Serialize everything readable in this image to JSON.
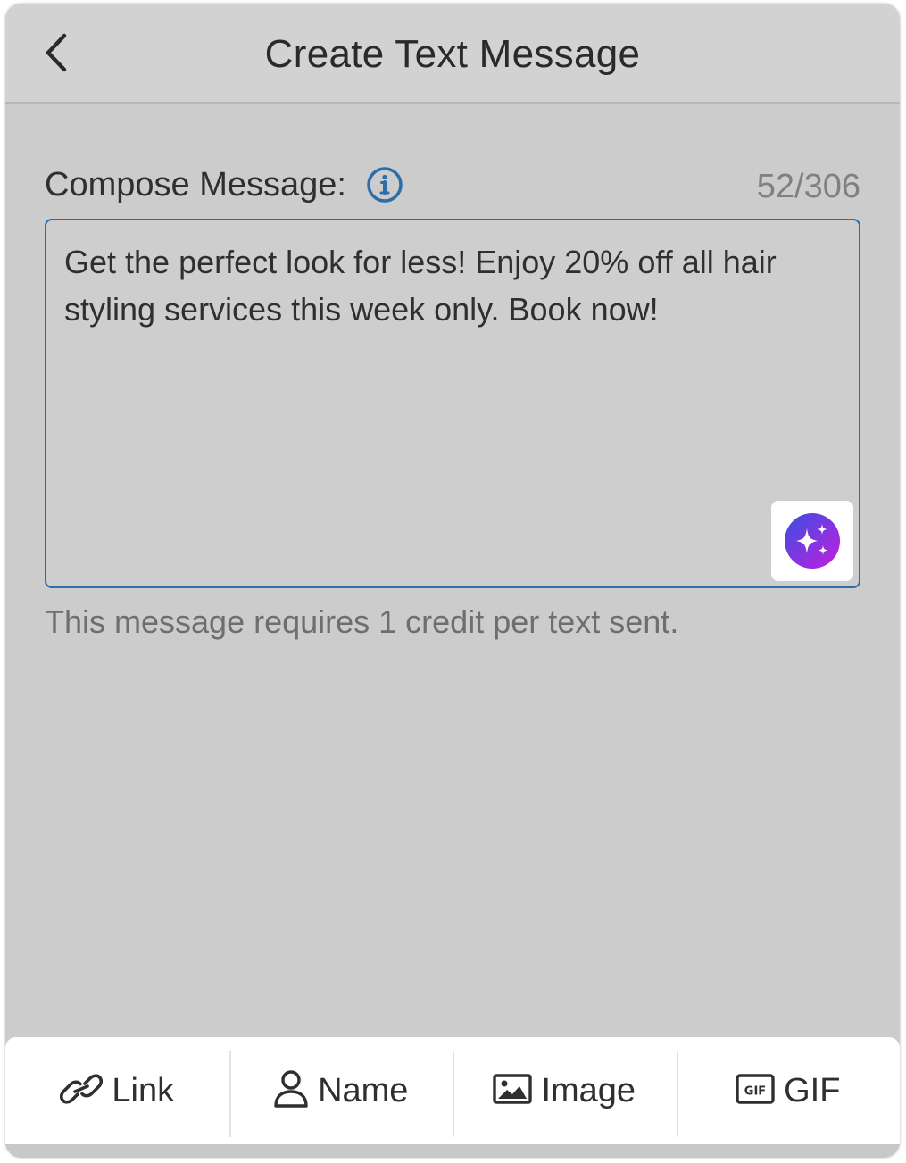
{
  "header": {
    "title": "Create Text Message",
    "back_icon": "chevron-left-icon"
  },
  "compose": {
    "label": "Compose Message:",
    "info_icon": "info-icon",
    "counter": "52/306",
    "message": "Get the perfect look for less! Enjoy 20% off all hair styling services this week only. Book now!",
    "ai_icon": "sparkles-icon",
    "credit_note": "This message requires 1 credit per text sent."
  },
  "toolbar": {
    "items": [
      {
        "label": "Link",
        "icon": "link-icon"
      },
      {
        "label": "Name",
        "icon": "person-icon"
      },
      {
        "label": "Image",
        "icon": "image-icon"
      },
      {
        "label": "GIF",
        "icon": "gif-icon"
      }
    ]
  },
  "colors": {
    "accent": "#2d6da8",
    "ai_gradient_start": "#3b4fe0",
    "ai_gradient_end": "#c21ee0"
  }
}
